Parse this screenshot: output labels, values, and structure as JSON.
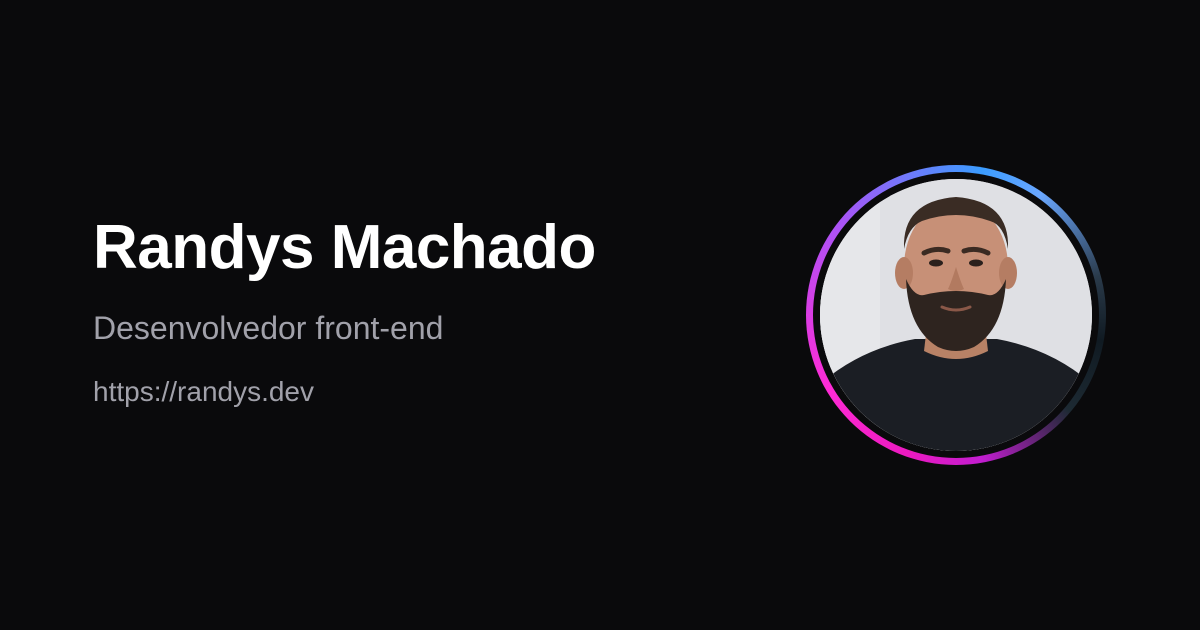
{
  "profile": {
    "name": "Randys Machado",
    "role": "Desenvolvedor front-end",
    "url": "https://randys.dev"
  },
  "avatar": {
    "description_icon": "profile-photo"
  },
  "colors": {
    "background": "#0a0a0c",
    "name_text": "#ffffff",
    "secondary_text": "#a1a1aa",
    "ring_pink": "#ff2bd6",
    "ring_purple": "#a855f7",
    "ring_blue": "#3b9cff"
  }
}
